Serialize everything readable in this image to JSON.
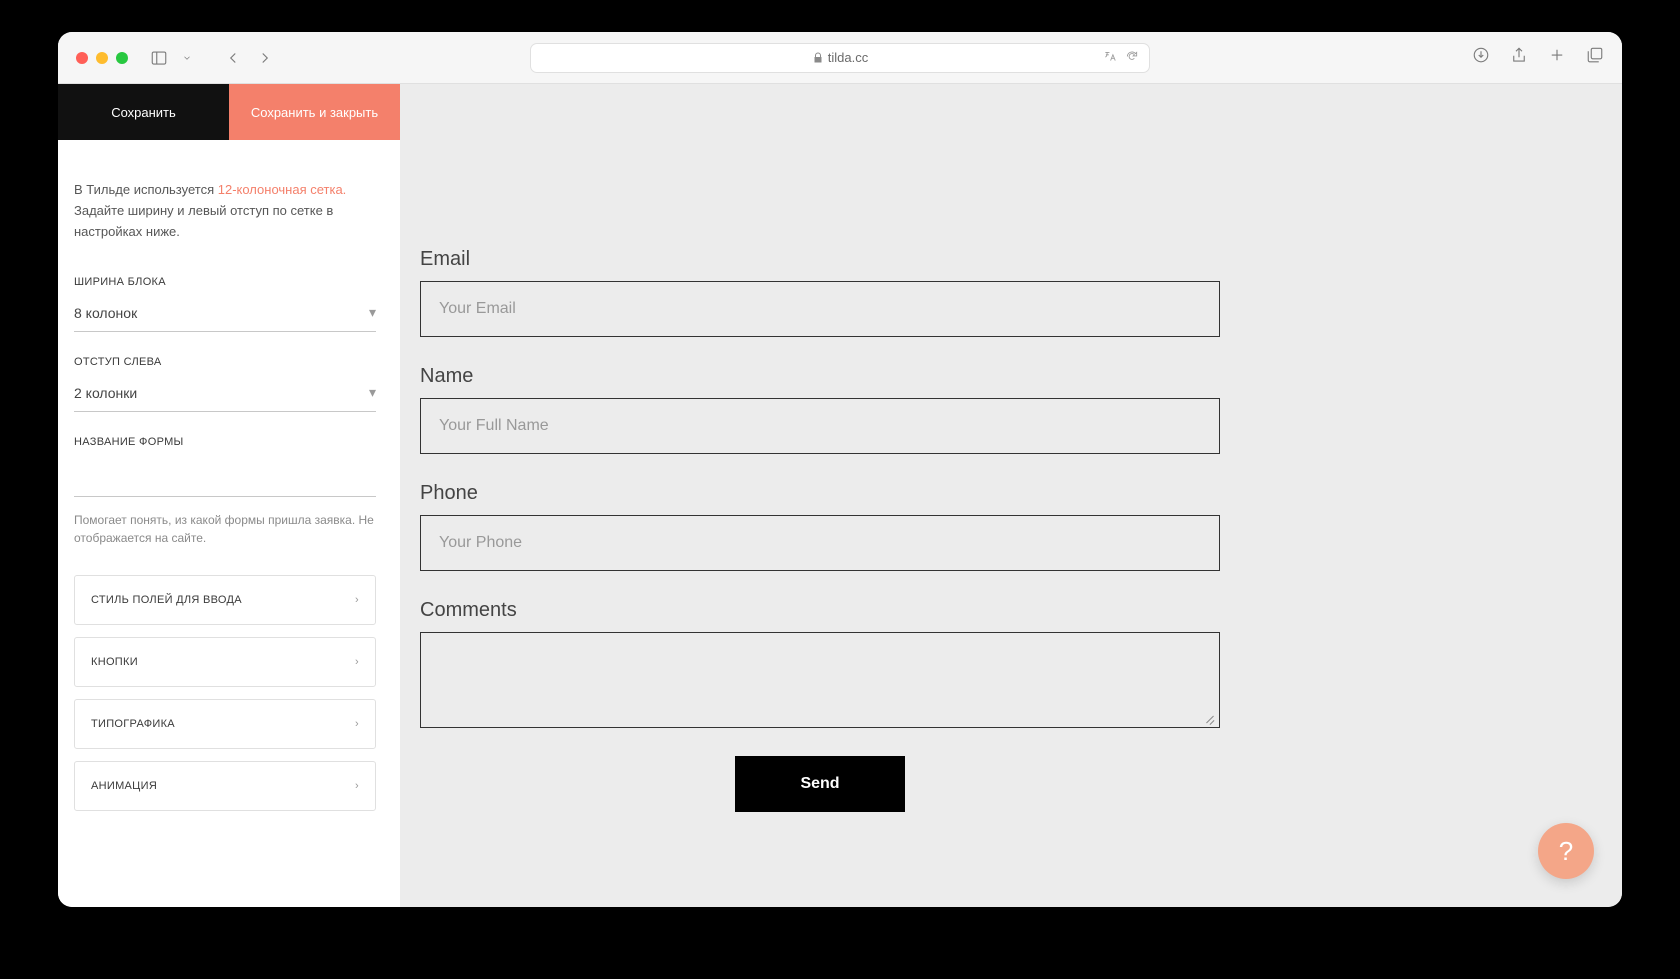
{
  "browser": {
    "url": "tilda.cc"
  },
  "sidebar": {
    "save_label": "Сохранить",
    "save_close_label": "Сохранить и закрыть",
    "hint_prefix": "В Тильде используется ",
    "hint_link": "12-колоночная сетка.",
    "hint_suffix": " Задайте ширину и левый отступ по сетке в настройках ниже.",
    "width_label": "ШИРИНА БЛОКА",
    "width_value": "8 колонок",
    "offset_label": "ОТСТУП СЛЕВА",
    "offset_value": "2 колонки",
    "formname_label": "НАЗВАНИЕ ФОРМЫ",
    "formname_value": "",
    "formname_hint": "Помогает понять, из какой формы пришла заявка. Не отображается на сайте.",
    "accordion": [
      "СТИЛЬ ПОЛЕЙ ДЛЯ ВВОДА",
      "КНОПКИ",
      "ТИПОГРАФИКА",
      "АНИМАЦИЯ"
    ]
  },
  "form": {
    "fields": [
      {
        "label": "Email",
        "placeholder": "Your Email"
      },
      {
        "label": "Name",
        "placeholder": "Your Full Name"
      },
      {
        "label": "Phone",
        "placeholder": "Your Phone"
      },
      {
        "label": "Comments",
        "placeholder": ""
      }
    ],
    "submit_label": "Send"
  },
  "help": {
    "glyph": "?"
  }
}
